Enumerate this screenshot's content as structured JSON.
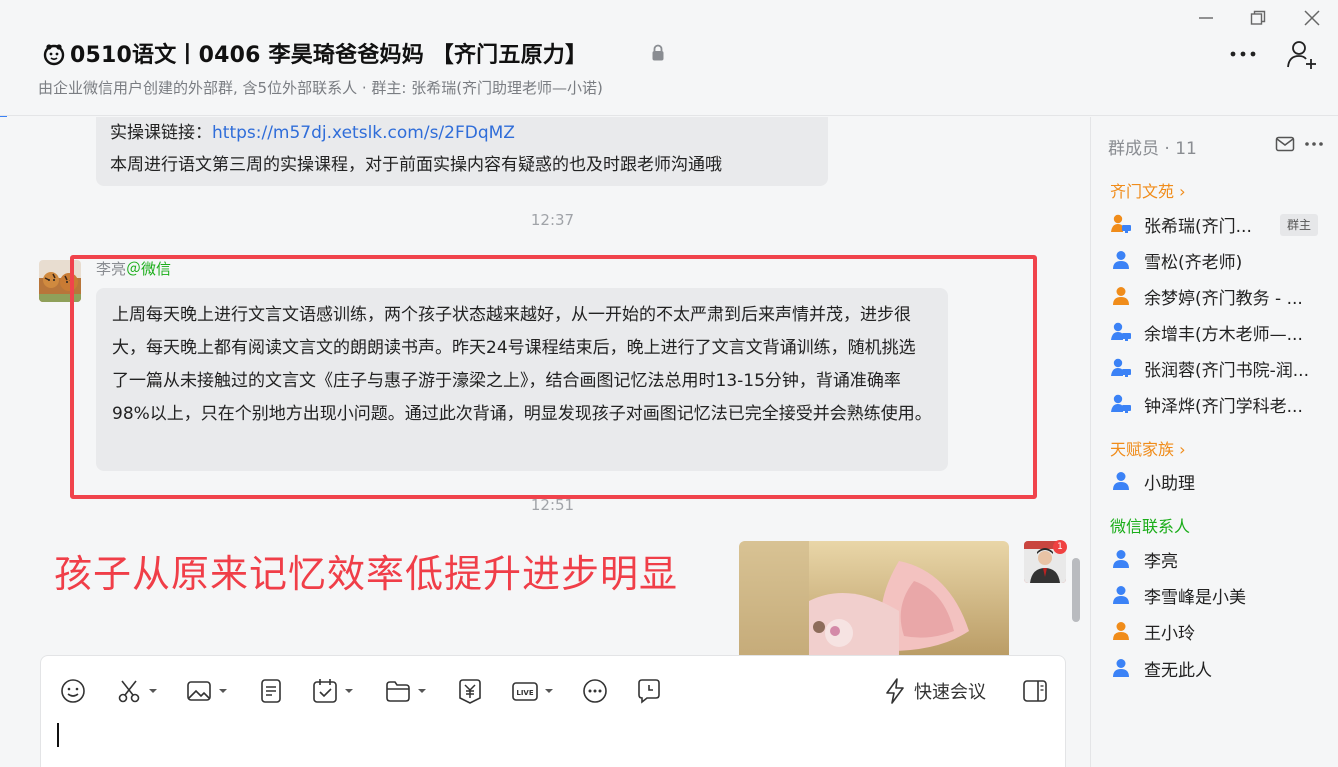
{
  "header": {
    "title": "0510语文丨0406  李昊琦爸爸妈妈 【齐门五原力】",
    "subtitle": "由企业微信用户创建的外部群, 含5位外部联系人 · 群主: 张希瑞(齐门助理老师—小诺)"
  },
  "chat": {
    "top_message": {
      "link_label": "实操课链接：",
      "link_url": "https://m57dj.xetslk.com/s/2FDqMZ",
      "line2": "本周进行语文第三周的实操课程，对于前面实操内容有疑惑的也及时跟老师沟通哦"
    },
    "timestamp_1": "12:37",
    "sender_name": "李亮",
    "sender_source": "＠微信",
    "main_message": "上周每天晚上进行文言文语感训练，两个孩子状态越来越好，从一开始的不太严肃到后来声情并茂，进步很大，每天晚上都有阅读文言文的朗朗读书声。昨天24号课程结束后，晚上进行了文言文背诵训练，随机挑选了一篇从未接触过的文言文《庄子与惠子游于濠梁之上》，结合画图记忆法总用时13-15分钟，背诵准确率98%以上，只在个别地方出现小问题。通过此次背诵，明显发现孩子对画图记忆法已完全接受并会熟练使用。",
    "timestamp_2": "12:51",
    "caption": "孩子从原来记忆效率低提升进步明显",
    "badge_count": "1"
  },
  "composer": {
    "quick_meeting_label": "快速会议",
    "input_value": ""
  },
  "sidebar": {
    "members_title": "群成员 · 11",
    "owner_tag": "群主",
    "groups": [
      {
        "label": "齐门文苑 ›",
        "color": "#f08c1a"
      },
      {
        "label": "天赋家族 ›",
        "color": "#f08c1a"
      },
      {
        "label": "微信联系人",
        "color": "#1aad19"
      }
    ],
    "members": [
      {
        "name": "张希瑞(齐门...",
        "icon": "enterprise-user-icon"
      },
      {
        "name": "雪松(齐老师)",
        "icon": "user-icon"
      },
      {
        "name": "余梦婷(齐门教务 - ...",
        "icon": "user-orange-icon"
      },
      {
        "name": "余增丰(方木老师—...",
        "icon": "enterprise-user-icon"
      },
      {
        "name": "张润蓉(齐门书院-润...",
        "icon": "enterprise-user-icon"
      },
      {
        "name": "钟泽烨(齐门学科老...",
        "icon": "enterprise-user-icon"
      },
      {
        "name": "小助理",
        "icon": "user-icon"
      },
      {
        "name": "李亮",
        "icon": "user-icon"
      },
      {
        "name": "李雪峰是小美",
        "icon": "user-icon"
      },
      {
        "name": "王小玲",
        "icon": "user-orange-icon"
      },
      {
        "name": "查无此人",
        "icon": "user-icon"
      }
    ]
  },
  "colors": {
    "accent_blue": "#3b82f6",
    "link": "#2f6dd9",
    "highlight_red": "#f0434c",
    "group_orange": "#f08c1a",
    "wechat_green": "#1aad19"
  }
}
